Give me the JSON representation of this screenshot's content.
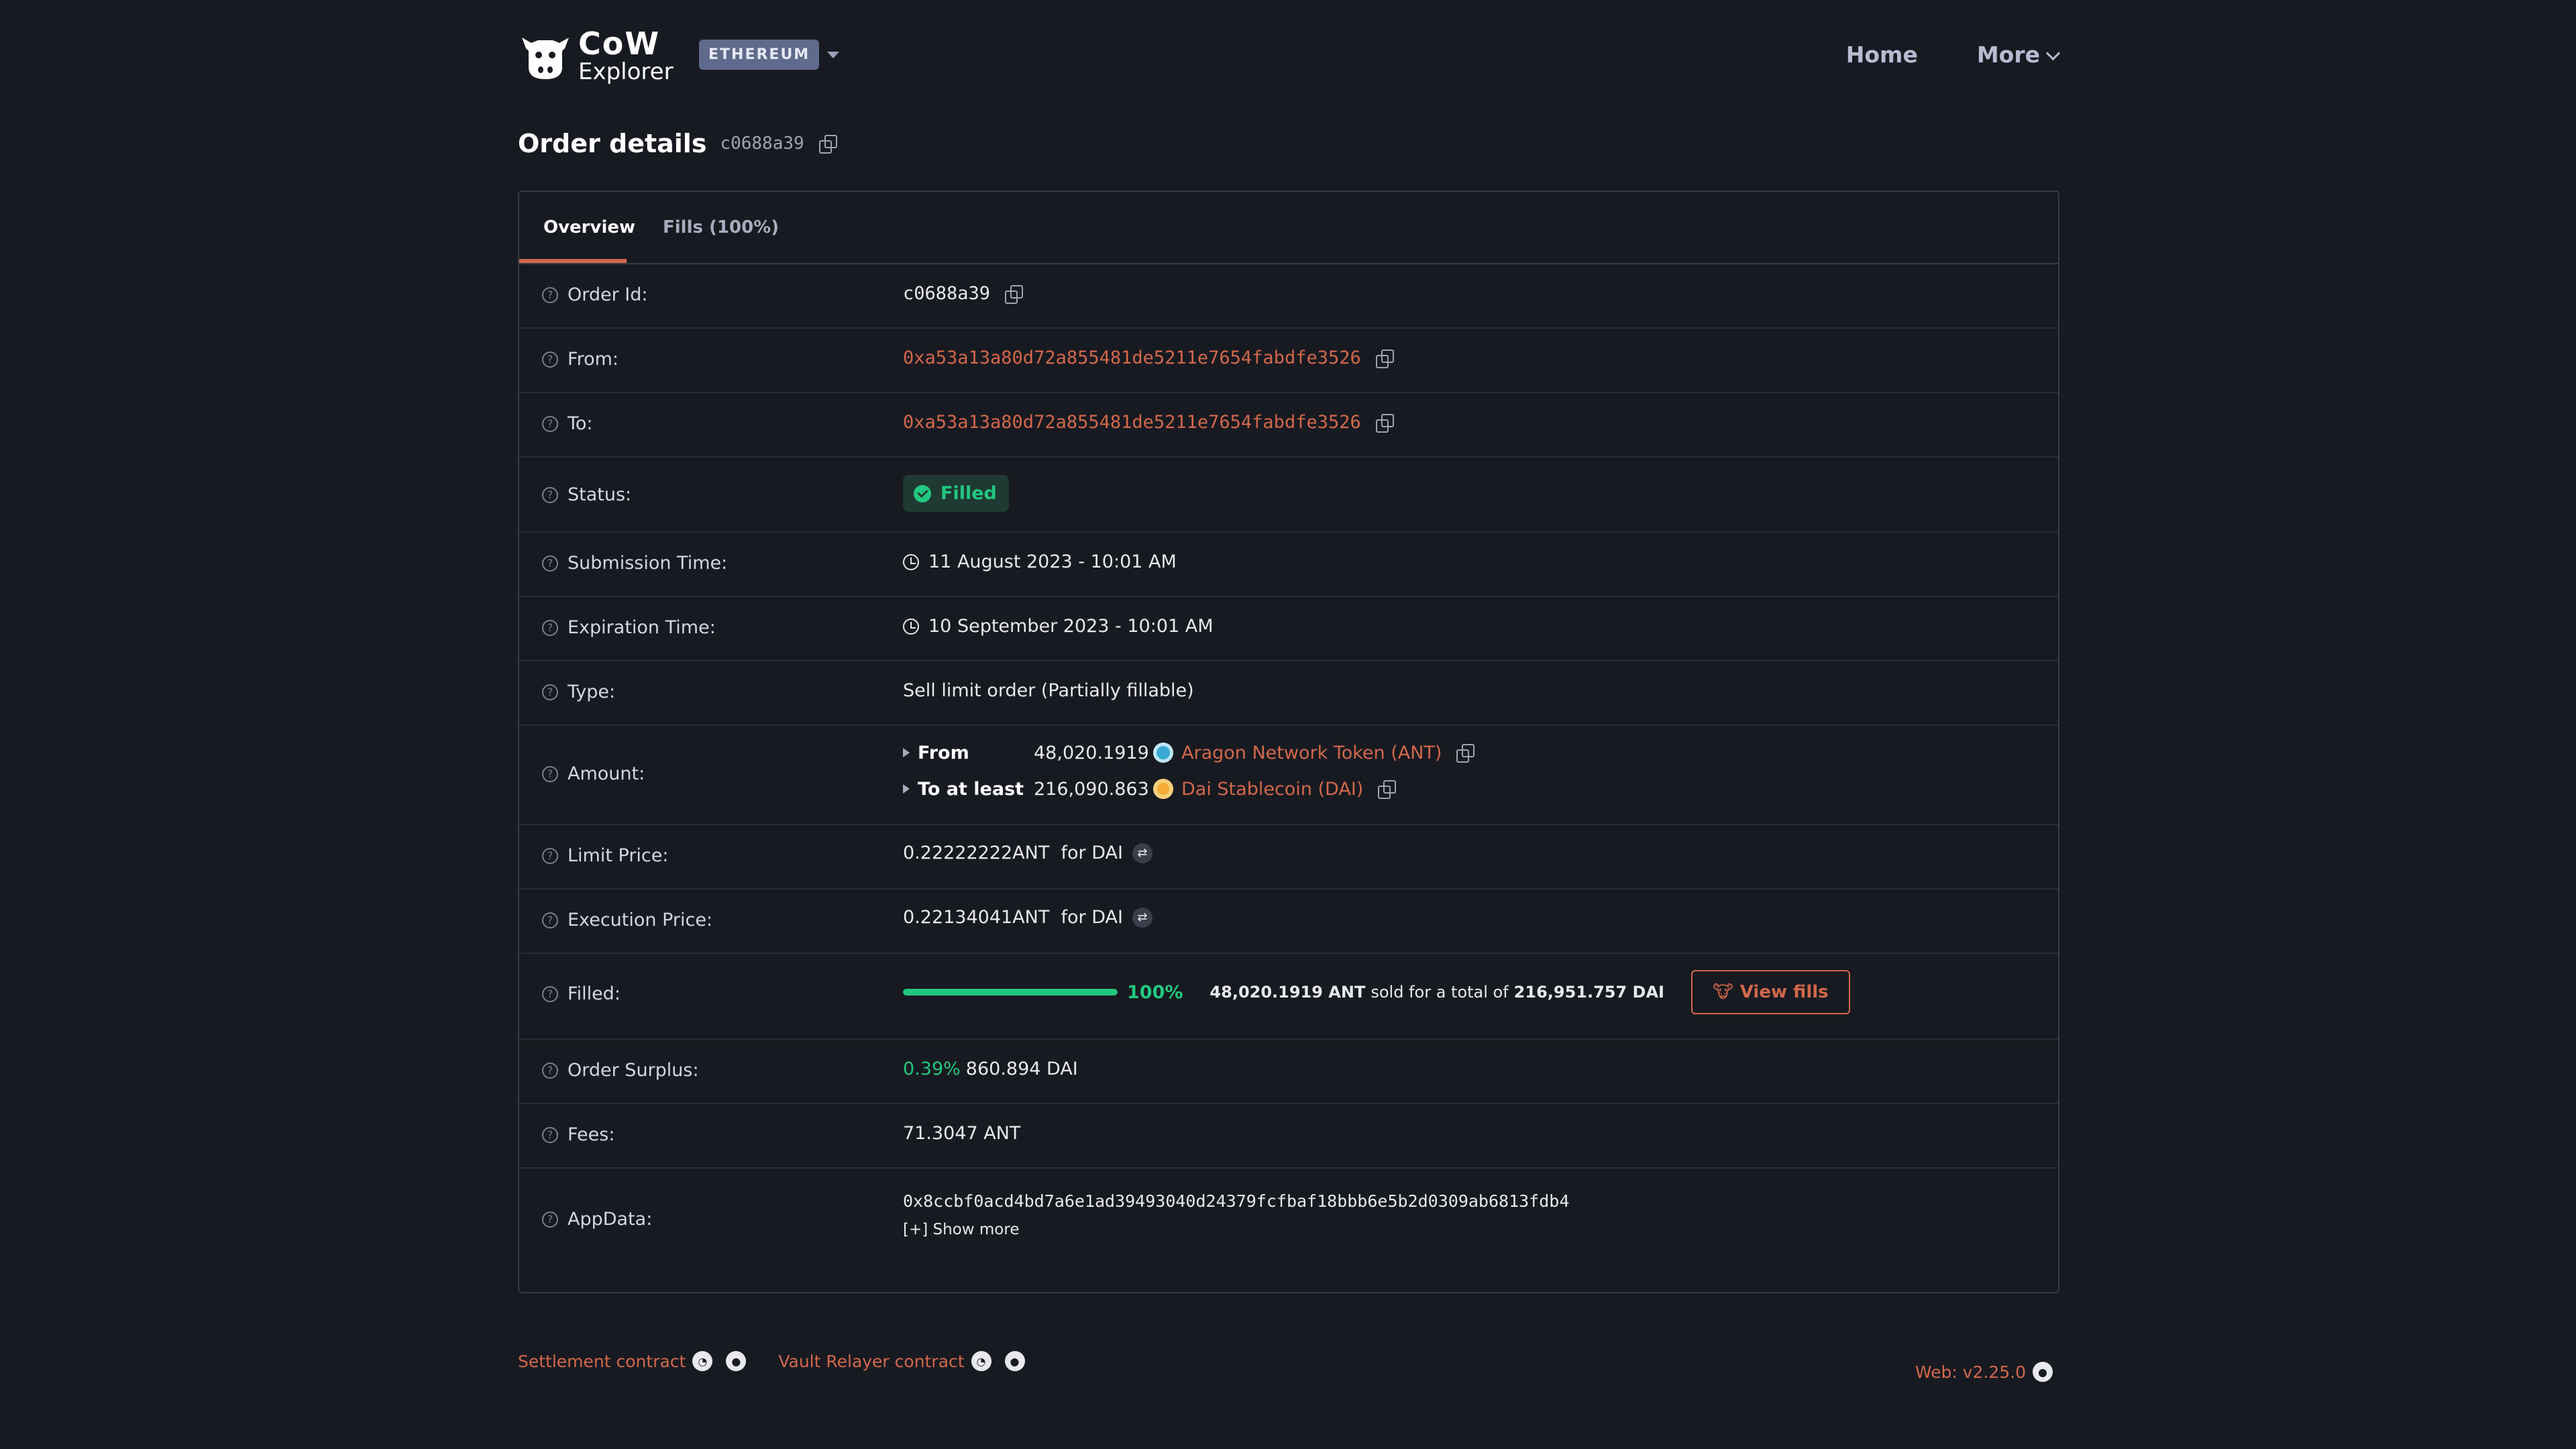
{
  "header": {
    "logo_cow": "CoW",
    "logo_explorer": "Explorer",
    "network": "ETHEREUM",
    "nav": {
      "home": "Home",
      "more": "More"
    }
  },
  "page": {
    "title": "Order details",
    "short_id": "c0688a39"
  },
  "tabs": {
    "overview": "Overview",
    "fills": "Fills (100%)"
  },
  "rows": {
    "order_id": {
      "label": "Order Id:",
      "value": "c0688a39"
    },
    "from": {
      "label": "From:",
      "value": "0xa53a13a80d72a855481de5211e7654fabdfe3526"
    },
    "to": {
      "label": "To:",
      "value": "0xa53a13a80d72a855481de5211e7654fabdfe3526"
    },
    "status": {
      "label": "Status:",
      "value": "Filled"
    },
    "submission": {
      "label": "Submission Time:",
      "value": "11 August 2023 - 10:01 AM"
    },
    "expiration": {
      "label": "Expiration Time:",
      "value": "10 September 2023 - 10:01 AM"
    },
    "type": {
      "label": "Type:",
      "value": "Sell limit order (Partially fillable)"
    },
    "amount": {
      "label": "Amount:",
      "from_label": "From",
      "from_value": "48,020.1919",
      "from_token": "Aragon Network Token (ANT)",
      "to_label": "To at least",
      "to_value": "216,090.863",
      "to_token": "Dai Stablecoin (DAI)"
    },
    "limit_price": {
      "label": "Limit Price:",
      "value": "0.22222222ANT  for DAI"
    },
    "execution_price": {
      "label": "Execution Price:",
      "value": "0.22134041ANT  for DAI"
    },
    "filled": {
      "label": "Filled:",
      "percent": "100%",
      "progress_fraction": 1.0,
      "sold": "48,020.1919 ANT",
      "mid": "sold for a total of",
      "total": "216,951.757 DAI",
      "button": "View fills"
    },
    "surplus": {
      "label": "Order Surplus:",
      "percent": "0.39%",
      "value": "860.894 DAI"
    },
    "fees": {
      "label": "Fees:",
      "value": "71.3047 ANT"
    },
    "appdata": {
      "label": "AppData:",
      "value": "0x8ccbf0acd4bd7a6e1ad39493040d24379fcfbaf18bbb6e5b2d0309ab6813fdb4",
      "show_more": "[+] Show more"
    }
  },
  "footer": {
    "settlement": "Settlement contract",
    "vault": "Vault Relayer contract",
    "version": "Web: v2.25.0"
  },
  "colors": {
    "accent": "#d2684b",
    "success": "#21c77f",
    "background": "#181a21"
  }
}
